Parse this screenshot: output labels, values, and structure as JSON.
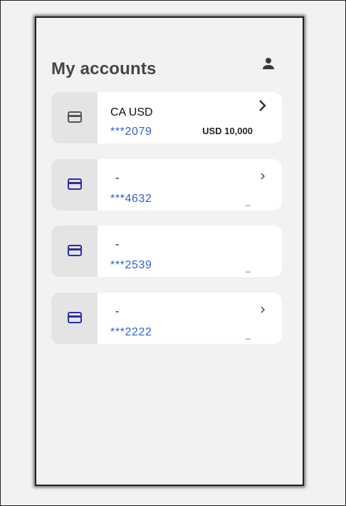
{
  "header": {
    "title": "My accounts",
    "profile_icon": "person-icon"
  },
  "accounts": [
    {
      "name": "CA USD",
      "number": "***2079",
      "balance": "USD 10,000",
      "icon": "credit-card-icon",
      "icon_color": "#555555"
    },
    {
      "name": "-",
      "number": "***4632",
      "balance": "_",
      "icon": "credit-card-icon",
      "icon_color": "#2b2fa0"
    },
    {
      "name": "-",
      "number": "***2539",
      "balance": "_",
      "icon": "credit-card-icon",
      "icon_color": "#2b2fa0"
    },
    {
      "name": "-",
      "number": "***2222",
      "balance": "_",
      "icon": "credit-card-icon",
      "icon_color": "#2b2fa0"
    }
  ],
  "colors": {
    "background": "#f2f2f2",
    "card": "#ffffff",
    "icon_panel": "#e4e4e4",
    "account_number": "#2f5fd0",
    "title": "#454545"
  }
}
